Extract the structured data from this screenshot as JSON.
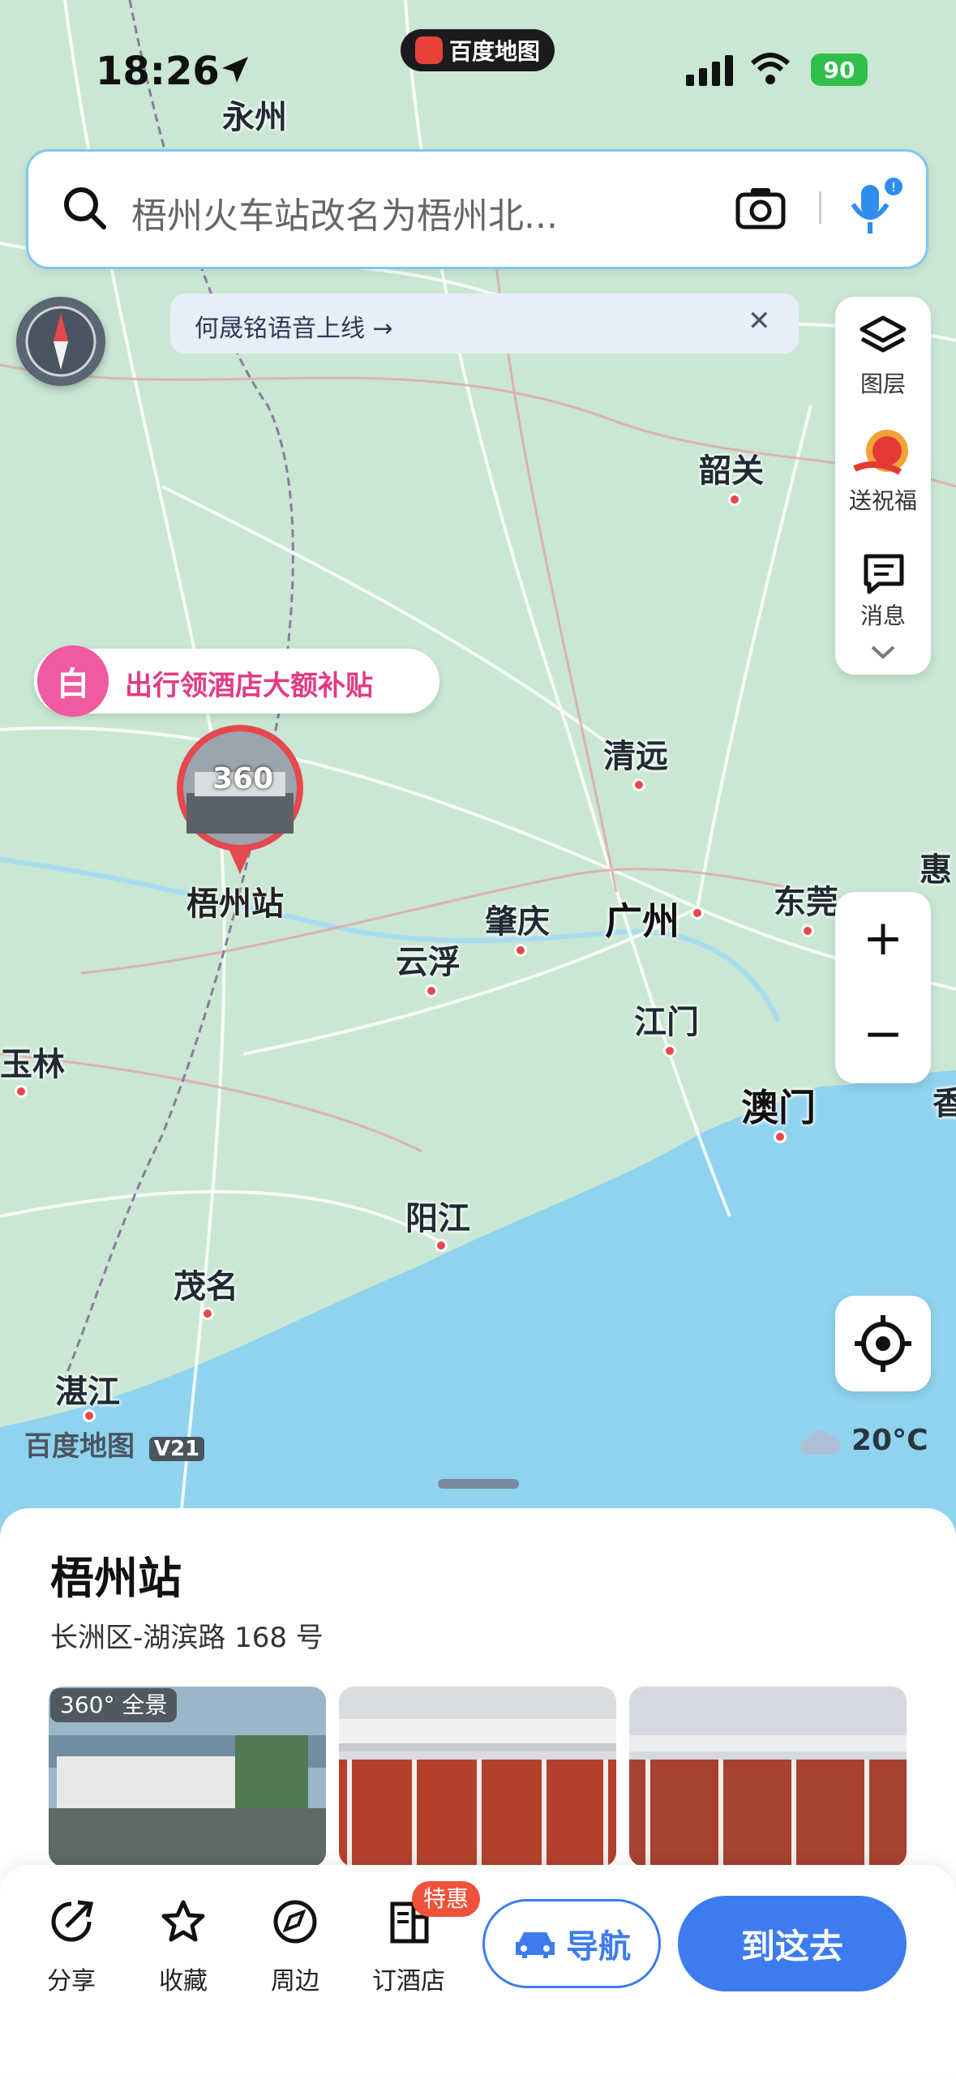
{
  "status_bar": {
    "time": "18:26",
    "app_name": "百度地图",
    "battery": "90"
  },
  "search": {
    "text": "梧州火车站改名为梧州北..."
  },
  "notice": {
    "text": "何晟铭语音上线 →",
    "close": "✕"
  },
  "right_panel": {
    "layers_label": "图层",
    "blessing_label": "送祝福",
    "message_label": "消息"
  },
  "promo": {
    "badge": "白",
    "text": "出行领酒店大额补贴"
  },
  "pin": {
    "label": "梧州站",
    "badge": "360"
  },
  "cities": {
    "yongzhou": "永州",
    "shaoguan": "韶关",
    "qingyuan": "清远",
    "zhaoqing": "肇庆",
    "guangzhou": "广州",
    "dongguan": "东莞",
    "hui": "惠",
    "yunfu": "云浮",
    "jiangmen": "江门",
    "macau": "澳门",
    "xiang": "香",
    "yulin": "玉林",
    "yangjiang": "阳江",
    "maoming": "茂名",
    "zhanjiang": "湛江"
  },
  "zoom": {
    "plus": "+",
    "minus": "−"
  },
  "brand": {
    "text": "百度地图",
    "version": "V21"
  },
  "weather": {
    "temp": "20°C"
  },
  "place": {
    "title": "梧州站",
    "address": "长洲区-湖滨路 168 号",
    "photo_tag": "360° 全景"
  },
  "bottom_bar": {
    "share": "分享",
    "favorite": "收藏",
    "nearby": "周边",
    "hotel": "订酒店",
    "hotel_badge": "特惠",
    "navigate": "导航",
    "go_here": "到这去"
  },
  "colors": {
    "accent": "#3d7cf0",
    "promo": "#e23a84",
    "pin": "#e5484d"
  }
}
